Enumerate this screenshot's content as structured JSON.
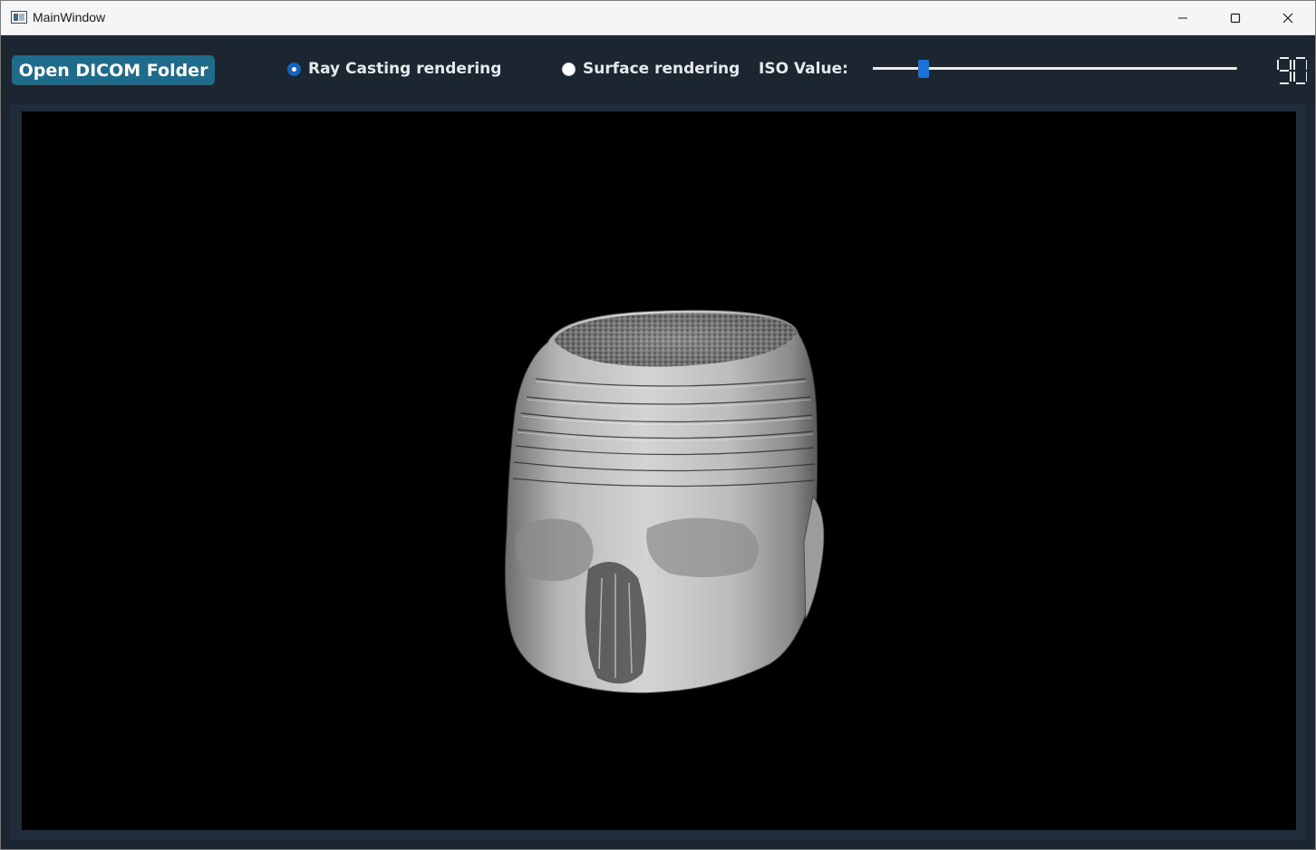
{
  "window": {
    "title": "MainWindow"
  },
  "toolbar": {
    "open_button_label": "Open DICOM Folder",
    "ray_casting_label": "Ray Casting rendering",
    "ray_casting_checked": true,
    "surface_label": "Surface rendering",
    "surface_checked": false,
    "iso_label": "ISO Value:",
    "iso_slider_fraction": 0.127,
    "iso_value_display": "90"
  },
  "colors": {
    "accent": "#1a73d9",
    "button_bg": "#1f6b8c",
    "panel_bg": "#1b2631",
    "view_bg": "#000000"
  },
  "icons": {
    "app": "app-window-icon",
    "minimize": "minimize-icon",
    "maximize": "maximize-icon",
    "close": "close-icon"
  }
}
